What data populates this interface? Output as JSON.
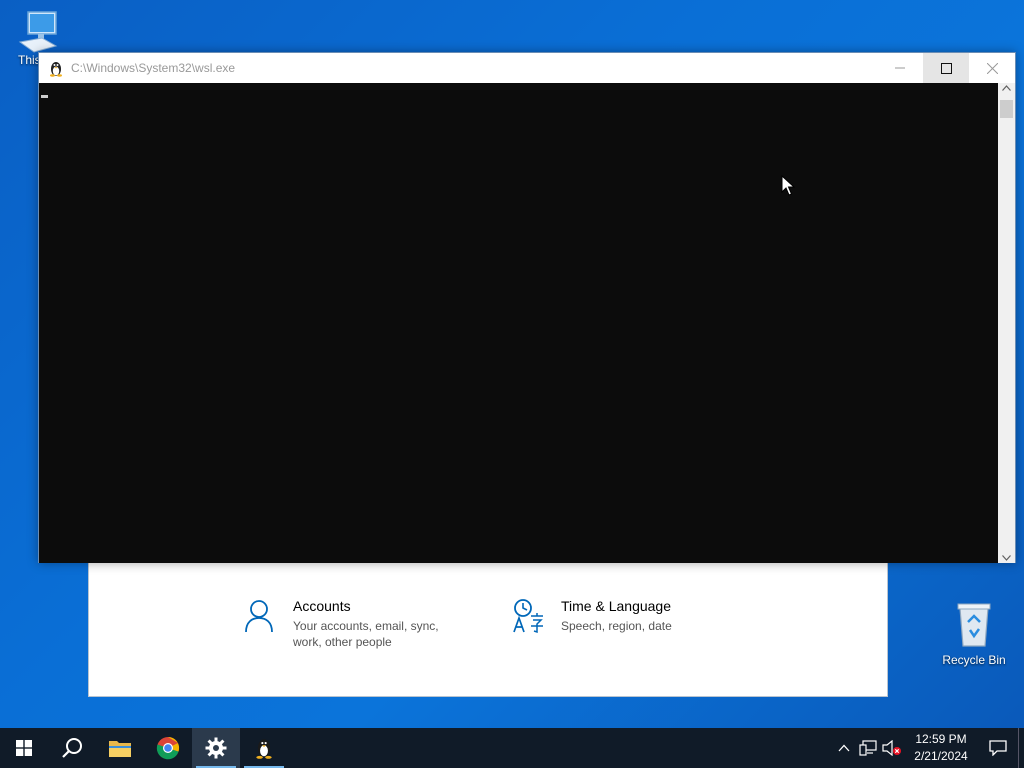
{
  "desktop": {
    "this_pc_label": "This",
    "recycle_bin_label": "Recycle Bin"
  },
  "settings": {
    "items": [
      {
        "title": "Accounts",
        "desc_line1": "Your accounts, email, sync,",
        "desc_line2": "work, other people",
        "icon": "person-icon"
      },
      {
        "title": "Time & Language",
        "desc_line1": "Speech, region, date",
        "desc_line2": "",
        "icon": "time-language-icon"
      }
    ]
  },
  "terminal": {
    "title": "C:\\Windows\\System32\\wsl.exe",
    "icon": "tux-icon"
  },
  "taskbar": {
    "apps": [
      "start",
      "search",
      "file-explorer",
      "chrome",
      "settings",
      "wsl"
    ],
    "active_app": "settings",
    "clock_time": "12:59 PM",
    "clock_date": "2/21/2024"
  },
  "colors": {
    "accent": "#0078d7",
    "taskbar": "#101b28",
    "terminal_bg": "#0c0c0c"
  }
}
